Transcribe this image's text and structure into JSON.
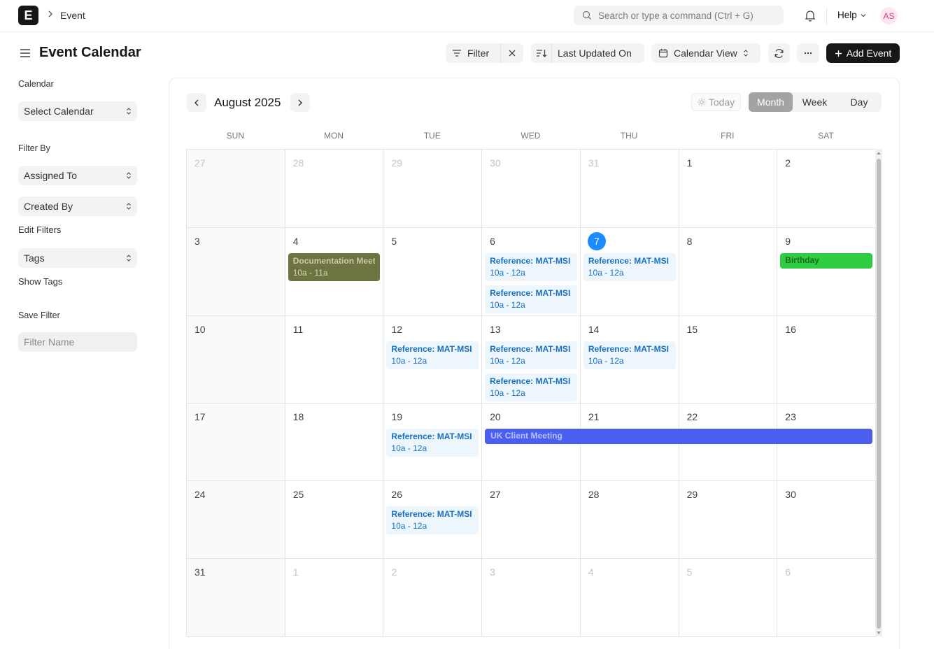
{
  "navbar": {
    "logo_letter": "E",
    "breadcrumb": "Event",
    "search_placeholder": "Search or type a command (Ctrl + G)",
    "help_label": "Help",
    "avatar_initials": "AS"
  },
  "header": {
    "title": "Event Calendar",
    "filter_label": "Filter",
    "sort_label": "Last Updated On",
    "view_label": "Calendar View",
    "add_label": "Add Event"
  },
  "sidebar": {
    "calendar_label": "Calendar",
    "calendar_select": "Select Calendar",
    "filter_by_label": "Filter By",
    "assigned_to": "Assigned To",
    "created_by": "Created By",
    "edit_filters": "Edit Filters",
    "tags": "Tags",
    "show_tags": "Show Tags",
    "save_filter_label": "Save Filter",
    "filter_name_placeholder": "Filter Name"
  },
  "calendar": {
    "month_label": "August 2025",
    "today_label": "Today",
    "views": [
      "Month",
      "Week",
      "Day"
    ],
    "active_view": "Month",
    "weekdays": [
      "SUN",
      "MON",
      "TUE",
      "WED",
      "THU",
      "FRI",
      "SAT"
    ],
    "weeks": [
      [
        {
          "d": "27",
          "o": true
        },
        {
          "d": "28",
          "o": true
        },
        {
          "d": "29",
          "o": true
        },
        {
          "d": "30",
          "o": true
        },
        {
          "d": "31",
          "o": true
        },
        {
          "d": "1"
        },
        {
          "d": "2"
        }
      ],
      [
        {
          "d": "3"
        },
        {
          "d": "4"
        },
        {
          "d": "5"
        },
        {
          "d": "6"
        },
        {
          "d": "7",
          "today": true
        },
        {
          "d": "8"
        },
        {
          "d": "9"
        }
      ],
      [
        {
          "d": "10"
        },
        {
          "d": "11"
        },
        {
          "d": "12"
        },
        {
          "d": "13"
        },
        {
          "d": "14"
        },
        {
          "d": "15"
        },
        {
          "d": "16"
        }
      ],
      [
        {
          "d": "17"
        },
        {
          "d": "18"
        },
        {
          "d": "19"
        },
        {
          "d": "20"
        },
        {
          "d": "21"
        },
        {
          "d": "22"
        },
        {
          "d": "23"
        }
      ],
      [
        {
          "d": "24"
        },
        {
          "d": "25"
        },
        {
          "d": "26"
        },
        {
          "d": "27"
        },
        {
          "d": "28"
        },
        {
          "d": "29"
        },
        {
          "d": "30"
        }
      ],
      [
        {
          "d": "31"
        },
        {
          "d": "1",
          "o": true
        },
        {
          "d": "2",
          "o": true
        },
        {
          "d": "3",
          "o": true
        },
        {
          "d": "4",
          "o": true
        },
        {
          "d": "5",
          "o": true
        },
        {
          "d": "6",
          "o": true
        }
      ]
    ],
    "events": [
      {
        "week": 1,
        "day": 1,
        "slot": 0,
        "title": "Documentation Meeting",
        "time": "10a - 11a",
        "kind": "doc"
      },
      {
        "week": 1,
        "day": 3,
        "slot": 0,
        "title": "Reference: MAT-MSI",
        "time": "10a - 12a",
        "kind": "ref"
      },
      {
        "week": 1,
        "day": 3,
        "slot": 1,
        "title": "Reference: MAT-MSI",
        "time": "10a - 12a",
        "kind": "ref"
      },
      {
        "week": 1,
        "day": 4,
        "slot": 0,
        "title": "Reference: MAT-MSI",
        "time": "10a - 12a",
        "kind": "ref"
      },
      {
        "week": 1,
        "day": 6,
        "slot": 0,
        "title": "Birthday",
        "time": "",
        "kind": "bday"
      },
      {
        "week": 2,
        "day": 2,
        "slot": 0,
        "title": "Reference: MAT-MSI",
        "time": "10a - 12a",
        "kind": "ref"
      },
      {
        "week": 2,
        "day": 3,
        "slot": 0,
        "title": "Reference: MAT-MSI",
        "time": "10a - 12a",
        "kind": "ref"
      },
      {
        "week": 2,
        "day": 3,
        "slot": 1,
        "title": "Reference: MAT-MSI",
        "time": "10a - 12a",
        "kind": "ref"
      },
      {
        "week": 2,
        "day": 4,
        "slot": 0,
        "title": "Reference: MAT-MSI",
        "time": "10a - 12a",
        "kind": "ref"
      },
      {
        "week": 3,
        "day": 2,
        "slot": 0,
        "title": "Reference: MAT-MSI",
        "time": "10a - 12a",
        "kind": "ref"
      },
      {
        "week": 3,
        "day": 3,
        "slot": 0,
        "span": 4,
        "title": "UK Client Meeting",
        "time": "",
        "kind": "uk"
      },
      {
        "week": 4,
        "day": 2,
        "slot": 0,
        "title": "Reference: MAT-MSI",
        "time": "10a - 12a",
        "kind": "ref"
      }
    ]
  },
  "colors": {
    "accent": "#171717",
    "today": "#1a8cff",
    "event_ref_bg": "#eef6fd",
    "event_ref_text": "#1670c5",
    "doc_event": "#6e7440",
    "birthday": "#2ecc40",
    "uk_event": "#4a5ff0"
  }
}
